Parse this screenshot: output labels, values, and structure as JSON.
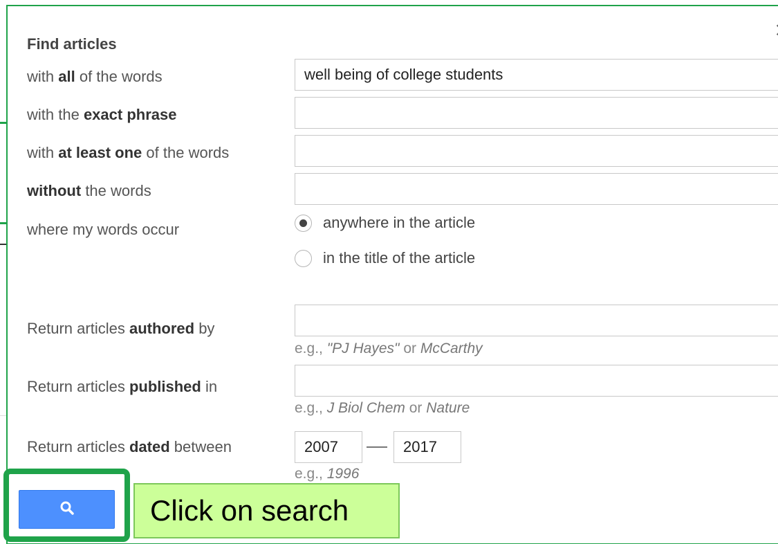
{
  "dialog": {
    "title": "Find articles",
    "close_glyph": "×"
  },
  "rows": {
    "all_words": {
      "prefix": "with ",
      "bold": "all",
      "suffix": " of the words",
      "value": "well being of college students"
    },
    "exact_phrase": {
      "prefix": "with the ",
      "bold": "exact phrase",
      "suffix": "",
      "value": ""
    },
    "at_least_one": {
      "prefix": "with ",
      "bold": "at least one",
      "suffix": " of the words",
      "value": ""
    },
    "without": {
      "prefix": "",
      "bold": "without",
      "suffix": " the words",
      "value": ""
    }
  },
  "occur": {
    "label": "where my words occur",
    "options": [
      {
        "label": "anywhere in the article",
        "selected": true
      },
      {
        "label": "in the title of the article",
        "selected": false
      }
    ]
  },
  "author": {
    "prefix": "Return articles ",
    "bold": "authored",
    "suffix": " by",
    "value": "",
    "hint_prefix": "e.g., ",
    "hint_a": "\"PJ Hayes\"",
    "hint_mid": " or ",
    "hint_b": "McCarthy"
  },
  "published": {
    "prefix": "Return articles ",
    "bold": "published",
    "suffix": " in",
    "value": "",
    "hint_prefix": "e.g., ",
    "hint_a": "J Biol Chem",
    "hint_mid": " or ",
    "hint_b": "Nature"
  },
  "dated": {
    "prefix": "Return articles ",
    "bold": "dated",
    "suffix": " between",
    "from": "2007",
    "to": "2017",
    "hint_prefix": "e.g., ",
    "hint_a": "1996"
  },
  "search_button": {
    "icon": "search-icon",
    "color": "#4d90fe"
  },
  "annotation": {
    "callout_text": "Click on search",
    "highlight_color": "#1fa34a",
    "callout_bg": "#ccff99"
  }
}
